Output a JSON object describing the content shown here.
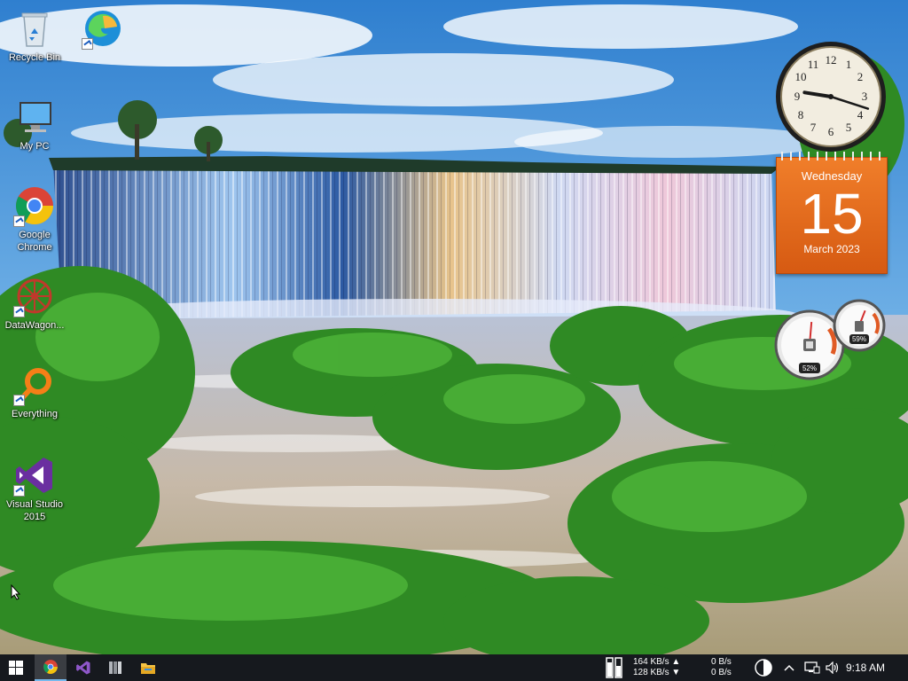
{
  "desktop": {
    "icons": [
      {
        "name": "recycle-bin",
        "label": "Recycle Bin"
      },
      {
        "name": "edge",
        "label": ""
      },
      {
        "name": "this-pc",
        "label": "My PC"
      },
      {
        "name": "chrome",
        "label": "Google Chrome"
      },
      {
        "name": "datawagon",
        "label": "DataWagon..."
      },
      {
        "name": "everything",
        "label": "Everything"
      },
      {
        "name": "visual-studio",
        "label": "Visual Studio 2015"
      }
    ]
  },
  "gadgets": {
    "clock": {
      "hour": 9,
      "minute": 18
    },
    "calendar": {
      "weekday": "Wednesday",
      "day": "15",
      "month_year": "March 2023"
    },
    "meters": {
      "cpu_label": "52%",
      "cpu_value": 0.52,
      "mem_label": "59%",
      "mem_value": 0.59
    }
  },
  "taskbar": {
    "buttons": [
      "start-button",
      "chrome-taskbar-button",
      "visual-studio-taskbar-button",
      "archive-taskbar-button",
      "file-explorer-taskbar-button"
    ],
    "net": {
      "down_rate": "164 KB/s",
      "up_rate": "128 KB/s",
      "disk_read": "0 B/s",
      "disk_write": "0 B/s"
    },
    "time": "9:18 AM"
  },
  "colors": {
    "taskbar_bg": "#16191e",
    "calendar_orange": "#e56a1d",
    "accent_blue": "#76b9ed"
  }
}
